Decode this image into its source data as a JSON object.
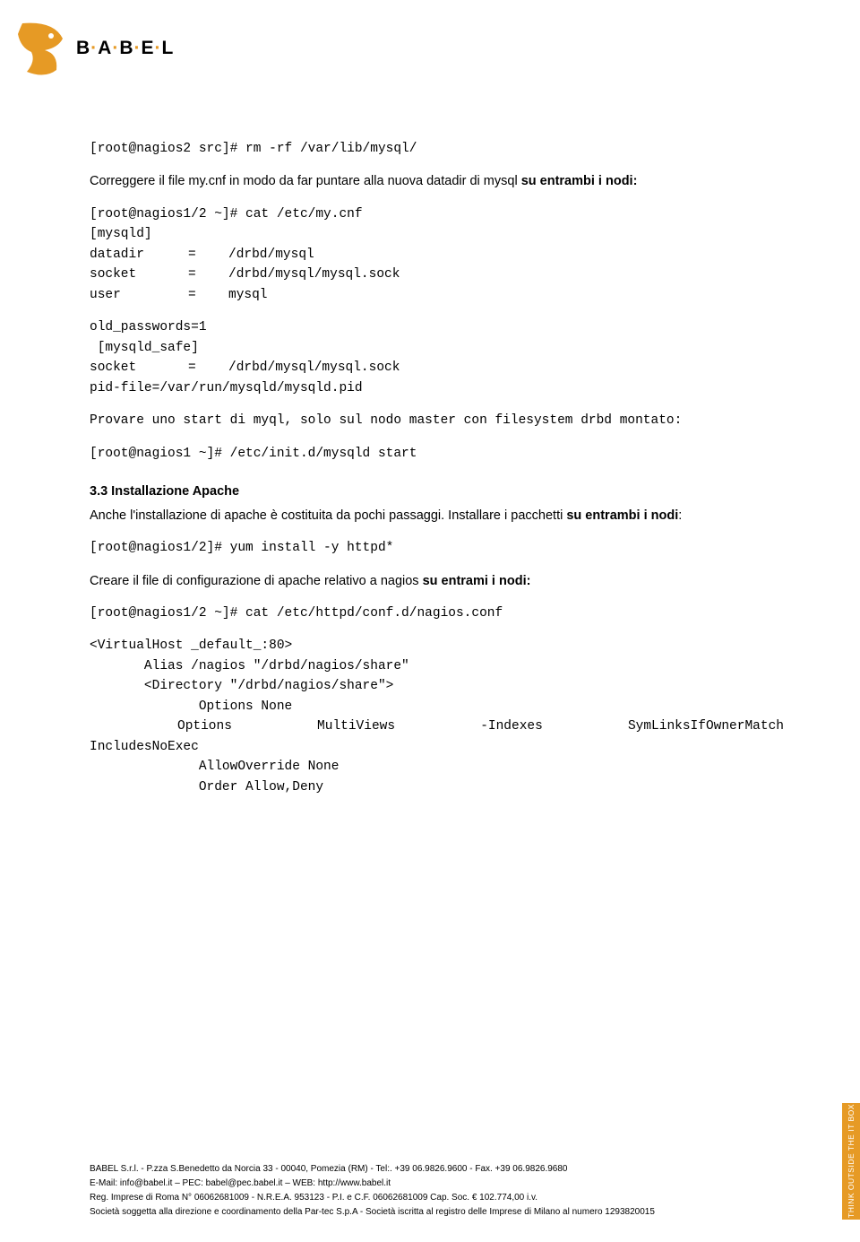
{
  "logo": {
    "text_parts": [
      "B",
      "A",
      "B",
      "E",
      "L"
    ]
  },
  "cmd1": "[root@nagios2 src]# rm -rf /var/lib/mysql/",
  "para1_a": "Correggere il file my.cnf in modo da far puntare alla nuova datadir di mysql ",
  "para1_b": "su entrambi i nodi:",
  "cmd2": "[root@nagios1/2 ~]# cat /etc/my.cnf",
  "cfg": {
    "section1": "[mysqld]",
    "datadir_k": "datadir",
    "datadir_v": "/drbd/mysql",
    "socket_k": "socket",
    "socket_v": "/drbd/mysql/mysql.sock",
    "user_k": "user",
    "user_v": "mysql",
    "oldpw": "old_passwords=1",
    "section2": " [mysqld_safe]",
    "socket2_k": "socket",
    "socket2_v": "/drbd/mysql/mysql.sock",
    "pidfile": "pid-file=/var/run/mysqld/mysqld.pid"
  },
  "para2": "Provare uno start di myql, solo sul nodo master con filesystem drbd montato:",
  "cmd3": "[root@nagios1 ~]# /etc/init.d/mysqld start",
  "heading": "3.3 Installazione Apache",
  "para3_a": "Anche l'installazione di apache è costituita da pochi passaggi. Installare i pacchetti ",
  "para3_b": "su entrambi i nodi",
  "cmd4": "[root@nagios1/2]# yum install -y httpd*",
  "para4_a": "Creare il file di configurazione di apache relativo a nagios ",
  "para4_b": "su entrami i nodi:",
  "cmd5": "[root@nagios1/2 ~]# cat /etc/httpd/conf.d/nagios.conf",
  "vhost": {
    "l1": "<VirtualHost _default_:80>",
    "l2": "       Alias /nagios \"/drbd/nagios/share\"",
    "l3": "       <Directory \"/drbd/nagios/share\">",
    "l4": "              Options None",
    "l5a": "Options",
    "l5b": "MultiViews",
    "l5c": "-Indexes",
    "l5d": "SymLinksIfOwnerMatch",
    "l6": "IncludesNoExec",
    "l7": "              AllowOverride None",
    "l8": "              Order Allow,Deny"
  },
  "footer": {
    "l1": "BABEL S.r.l. - P.zza S.Benedetto da Norcia 33 - 00040, Pomezia (RM) - Tel:. +39 06.9826.9600 - Fax. +39 06.9826.9680",
    "l2": "E-Mail: info@babel.it – PEC: babel@pec.babel.it – WEB: http://www.babel.it",
    "l3": "Reg. Imprese di Roma N° 06062681009 - N.R.E.A. 953123 - P.I. e C.F. 06062681009 Cap. Soc. € 102.774,00 i.v.",
    "l4": "Società soggetta alla direzione e coordinamento della Par-tec S.p.A - Società iscritta al registro delle Imprese di Milano al numero 1293820015"
  },
  "side_tab": "THINK OUTSIDE THE IT BOX"
}
